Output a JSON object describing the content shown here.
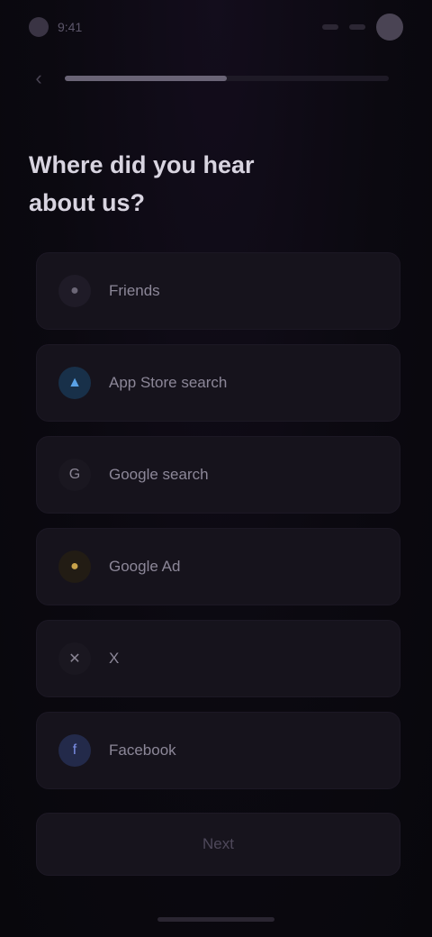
{
  "status_bar": {
    "time": "9:41"
  },
  "header": {
    "back_icon": "chevron-left-icon",
    "progress_percent": 50
  },
  "title": "Where did you hear about us?",
  "options": [
    {
      "label": "Friends",
      "icon": "users-icon",
      "icon_color": "#6b6676",
      "icon_bg": "#1f1b27"
    },
    {
      "label": "App Store search",
      "icon": "app-store-icon",
      "icon_color": "#5aa2e6",
      "icon_bg": "#183049"
    },
    {
      "label": "Google search",
      "icon": "google-icon",
      "icon_color": "#8a8594",
      "icon_bg": "#1a1720"
    },
    {
      "label": "Google Ad",
      "icon": "ad-icon",
      "icon_color": "#c8a24a",
      "icon_bg": "#221c14"
    },
    {
      "label": "X",
      "icon": "x-icon",
      "icon_color": "#8a8594",
      "icon_bg": "#1a1720"
    },
    {
      "label": "Facebook",
      "icon": "facebook-icon",
      "icon_color": "#7b8fe6",
      "icon_bg": "#232a4a"
    }
  ],
  "continue_label": "Next",
  "colors": {
    "background": "#0b0910",
    "card": "#16131c"
  }
}
